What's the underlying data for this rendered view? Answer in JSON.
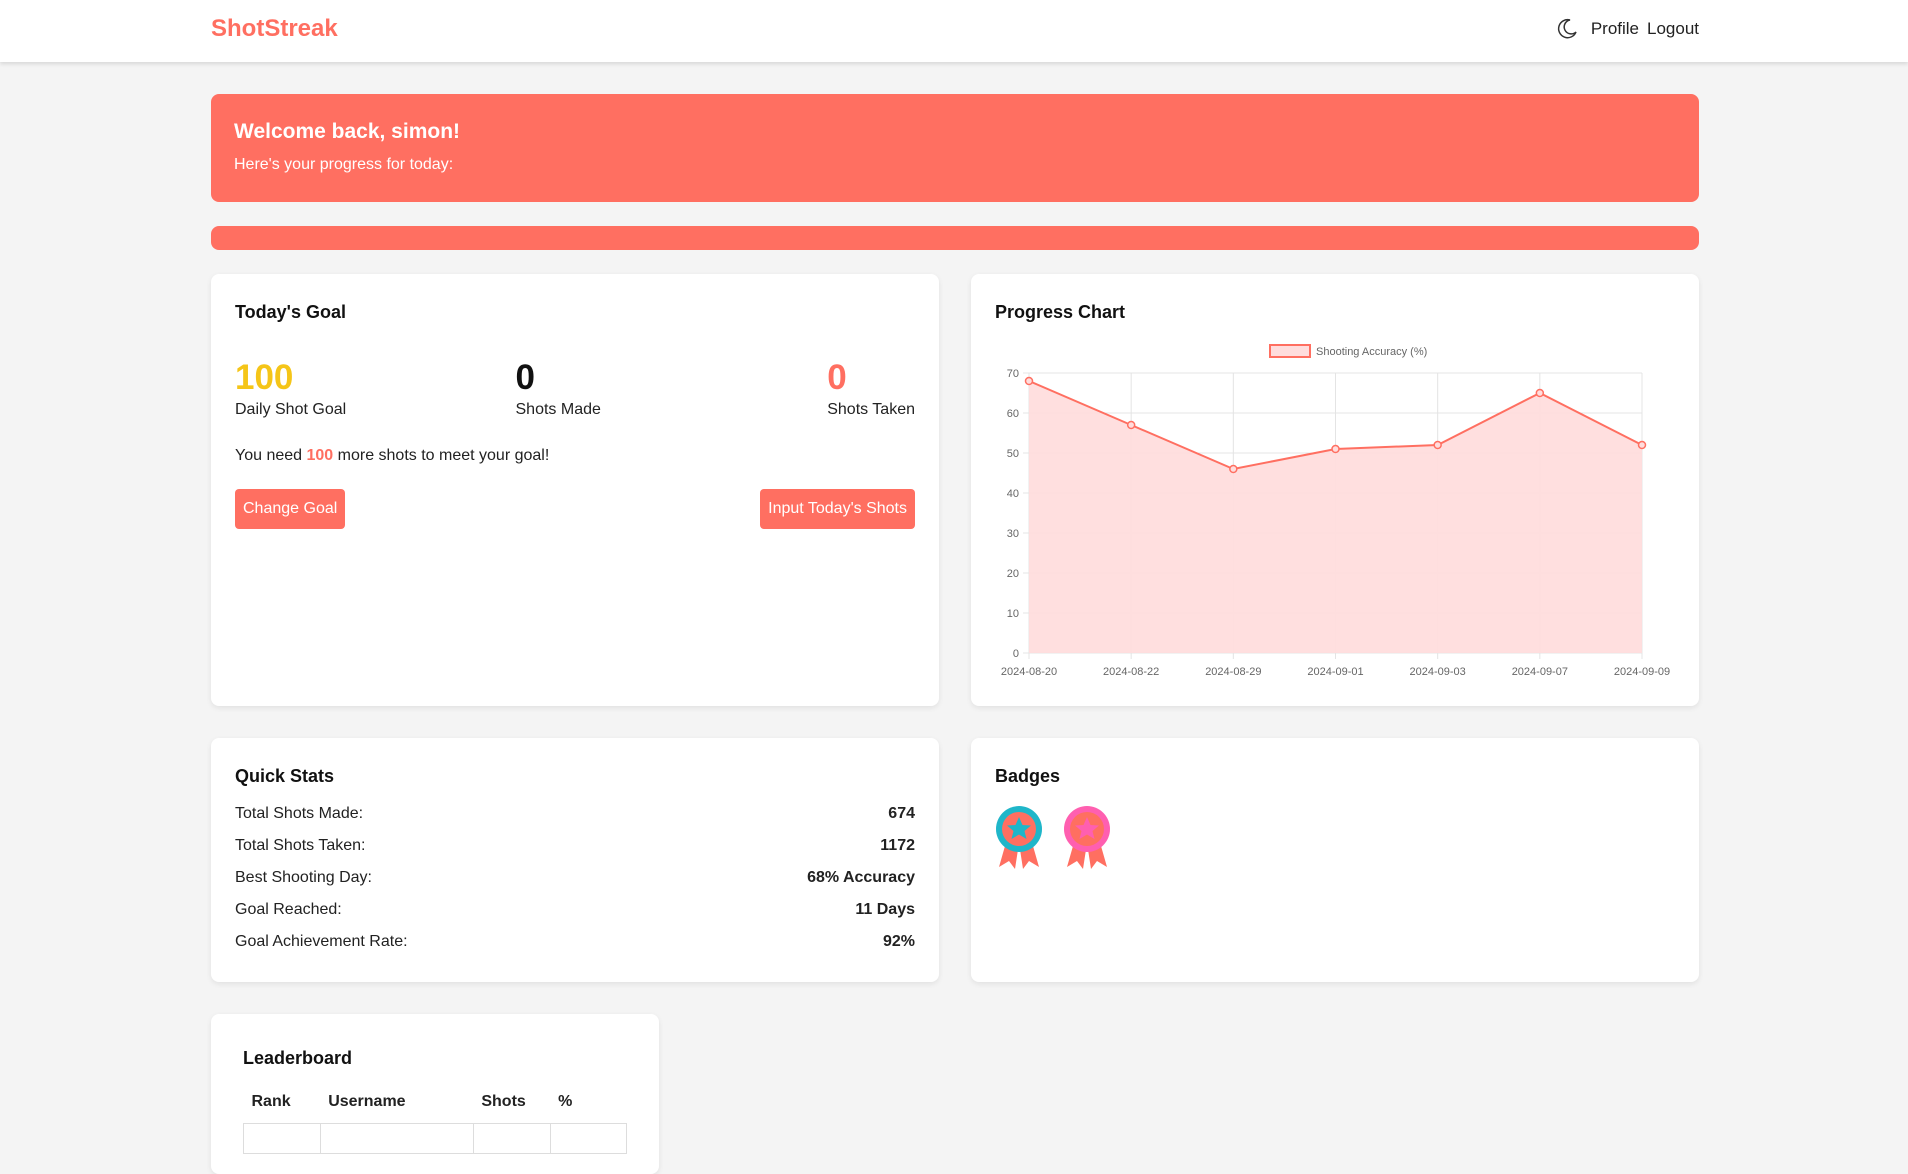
{
  "nav": {
    "brand": "ShotStreak",
    "profile": "Profile",
    "logout": "Logout"
  },
  "hero": {
    "title": "Welcome back, simon!",
    "subtitle": "Here's your progress for today:"
  },
  "goal": {
    "title": "Today's Goal",
    "daily_goal_value": "100",
    "daily_goal_label": "Daily Shot Goal",
    "made_value": "0",
    "made_label": "Shots Made",
    "taken_value": "0",
    "taken_label": "Shots Taken",
    "need_prefix": "You need ",
    "need_value": "100",
    "need_suffix": " more shots to meet your goal!",
    "change_button": "Change Goal",
    "input_button": "Input Today's Shots"
  },
  "chart_data": {
    "type": "line",
    "title": "Progress Chart",
    "x": [
      "2024-08-20",
      "2024-08-22",
      "2024-08-29",
      "2024-09-01",
      "2024-09-03",
      "2024-09-07",
      "2024-09-09"
    ],
    "series": [
      {
        "name": "Shooting Accuracy (%)",
        "values": [
          68,
          57,
          46,
          51,
          52,
          65,
          52
        ]
      }
    ],
    "ylim": [
      0,
      70
    ],
    "yticks": [
      "0",
      "10",
      "20",
      "30",
      "40",
      "50",
      "60",
      "70"
    ],
    "grid": true,
    "legend": "top-center",
    "line_color": "#ff6f61",
    "fill_color": "#ffdddd"
  },
  "quick": {
    "title": "Quick Stats",
    "rows": [
      {
        "label": "Total Shots Made:",
        "value": "674"
      },
      {
        "label": "Total Shots Taken:",
        "value": "1172"
      },
      {
        "label": "Best Shooting Day:",
        "value": "68% Accuracy"
      },
      {
        "label": "Goal Reached:",
        "value": "11 Days"
      },
      {
        "label": "Goal Achievement Rate:",
        "value": "92%"
      }
    ]
  },
  "badges": {
    "title": "Badges",
    "items": [
      "badge-teal-icon",
      "badge-pink-icon"
    ]
  },
  "leaderboard": {
    "title": "Leaderboard",
    "headers": [
      "Rank",
      "Username",
      "Shots",
      "%"
    ]
  },
  "colors": {
    "accent": "#ff6f61",
    "goal_yellow": "#f5c518",
    "badge_teal": "#1fb6c9",
    "badge_pink": "#ff5fb0"
  }
}
